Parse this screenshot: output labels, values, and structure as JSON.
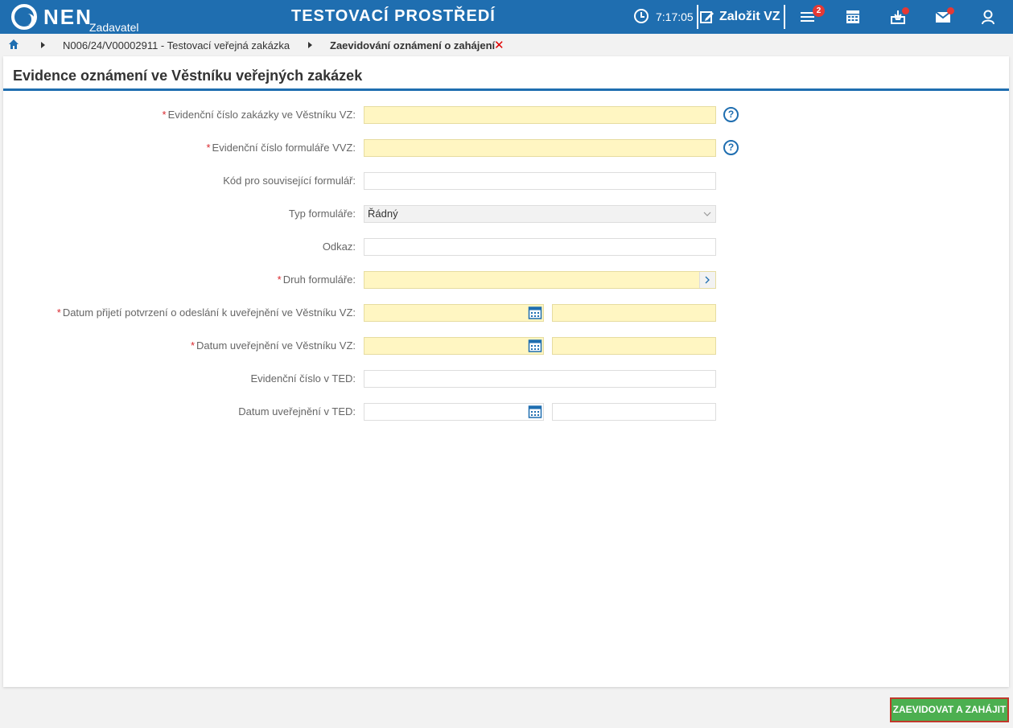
{
  "header": {
    "logo_text": "NEN",
    "logo_sub": "Zadavatel",
    "env_title": "TESTOVACÍ PROSTŘEDÍ",
    "time": "7:17:05",
    "create_label": "Založit VZ",
    "tasks_badge": "2",
    "icons": [
      "clock-icon",
      "edit-icon",
      "menu-icon",
      "calculator-icon",
      "inbox-icon",
      "mail-icon",
      "user-icon"
    ],
    "notification_color": "#e53935",
    "brand_color": "#1f6eb0"
  },
  "breadcrumb": {
    "item1": "N006/24/V00002911 - Testovací veřejná zakázka",
    "item2": "Zaevidování oznámení o zahájení"
  },
  "panel": {
    "title": "Evidence oznámení ve Věstníku veřejných zakázek"
  },
  "form": {
    "fields": [
      {
        "label": "Evidenční číslo zakázky ve Věstníku VZ:",
        "required": true,
        "value": ""
      },
      {
        "label": "Evidenční číslo formuláře VVZ:",
        "required": true,
        "value": ""
      },
      {
        "label": "Kód pro související formulář:",
        "required": false,
        "value": ""
      },
      {
        "label": "Typ formuláře:",
        "required": false,
        "value": "Řádný"
      },
      {
        "label": "Odkaz:",
        "required": false,
        "value": ""
      },
      {
        "label": "Druh formuláře:",
        "required": true,
        "value": ""
      },
      {
        "label": "Datum přijetí potvrzení o odeslání k uveřejnění ve Věstníku VZ:",
        "required": true,
        "value": ""
      },
      {
        "label": "Datum uveřejnění ve Věstníku VZ:",
        "required": true,
        "value": ""
      },
      {
        "label": "Evidenční číslo v TED:",
        "required": false,
        "value": ""
      },
      {
        "label": "Datum uveřejnění v TED:",
        "required": false,
        "value": ""
      }
    ],
    "required_mark": "*",
    "help_mark": "?",
    "required_bg": "#fff6c2"
  },
  "actions": {
    "submit_label": "ZAEVIDOVAT A ZAHÁJIT",
    "submit_color": "#4caf50"
  }
}
